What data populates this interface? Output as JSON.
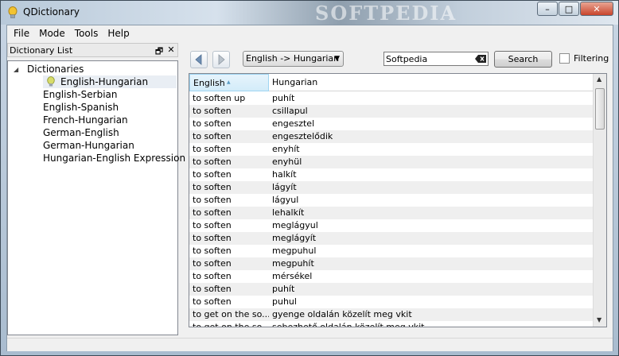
{
  "window": {
    "title": "QDictionary",
    "watermark": "SOFTPEDIA",
    "minimize_glyph": "–",
    "maximize_glyph": "□",
    "close_glyph": "✕"
  },
  "menu": [
    "File",
    "Mode",
    "Tools",
    "Help"
  ],
  "dock": {
    "title": "Dictionary List",
    "float_glyph": "🗗",
    "close_glyph": "✕",
    "root_label": "Dictionaries",
    "items": [
      "English-Hungarian",
      "English-Serbian",
      "English-Spanish",
      "French-Hungarian",
      "German-English",
      "German-Hungarian",
      "Hungarian-English Expression"
    ],
    "selected_item": "English-Hungarian"
  },
  "toolbar": {
    "direction": "English -> Hungarian",
    "search_value": "Softpedia",
    "search_button": "Search",
    "filter_label": "Filtering",
    "filter_checked": false
  },
  "results": {
    "columns": [
      "English",
      "Hungarian"
    ],
    "rows": [
      [
        "to soften up",
        "puhít"
      ],
      [
        "to soften",
        "csillapul"
      ],
      [
        "to soften",
        "engesztel"
      ],
      [
        "to soften",
        "engesztelődik"
      ],
      [
        "to soften",
        "enyhít"
      ],
      [
        "to soften",
        "enyhül"
      ],
      [
        "to soften",
        "halkít"
      ],
      [
        "to soften",
        "lágyít"
      ],
      [
        "to soften",
        "lágyul"
      ],
      [
        "to soften",
        "lehalkít"
      ],
      [
        "to soften",
        "meglágyul"
      ],
      [
        "to soften",
        "meglágyít"
      ],
      [
        "to soften",
        "megpuhul"
      ],
      [
        "to soften",
        "megpuhít"
      ],
      [
        "to soften",
        "mérsékel"
      ],
      [
        "to soften",
        "puhít"
      ],
      [
        "to soften",
        "puhul"
      ],
      [
        "to get on the so...",
        "gyenge oldalán közelít meg vkit"
      ],
      [
        "to get on the so...",
        "sebezhető oldalán közelít meg vkit"
      ]
    ]
  },
  "icons": {
    "app": "dictionary-bulb-icon",
    "back": "back-arrow-icon",
    "forward": "forward-arrow-icon",
    "clear": "clear-text-icon"
  },
  "colors": {
    "selection": "#e9eef4",
    "header_sorted": "#d3ecf9"
  }
}
